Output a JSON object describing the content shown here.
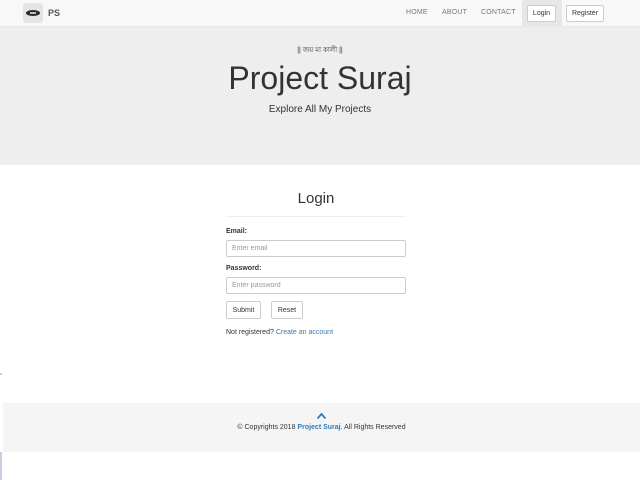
{
  "navbar": {
    "brand_icon": "sun-logo-icon",
    "brand": "PS",
    "links": [
      "HOME",
      "ABOUT",
      "CONTACT"
    ],
    "login_label": "Login",
    "register_label": "Register"
  },
  "jumbotron": {
    "motto": "|| জয় মা কালী ||",
    "title": "Project Suraj",
    "subtitle": "Explore All My Projects"
  },
  "login_form": {
    "title": "Login",
    "email_label": "Email:",
    "email_placeholder": "Enter email",
    "email_value": "",
    "password_label": "Password:",
    "password_placeholder": "Enter password",
    "password_value": "",
    "submit_label": "Submit",
    "reset_label": "Reset",
    "register_prompt": "Not registered?",
    "register_link": "Create an account"
  },
  "footer": {
    "up_icon": "chevron-up-icon",
    "copyright_prefix": "© Copyrights 2018",
    "brand": "Project Suraj",
    "copyright_suffix": ". All Rights Reserved"
  },
  "colors": {
    "link": "#337ab7",
    "navbar_bg": "#f8f8f8",
    "jumbotron_bg": "#eeeeee",
    "footer_bg": "#f5f5f5"
  }
}
